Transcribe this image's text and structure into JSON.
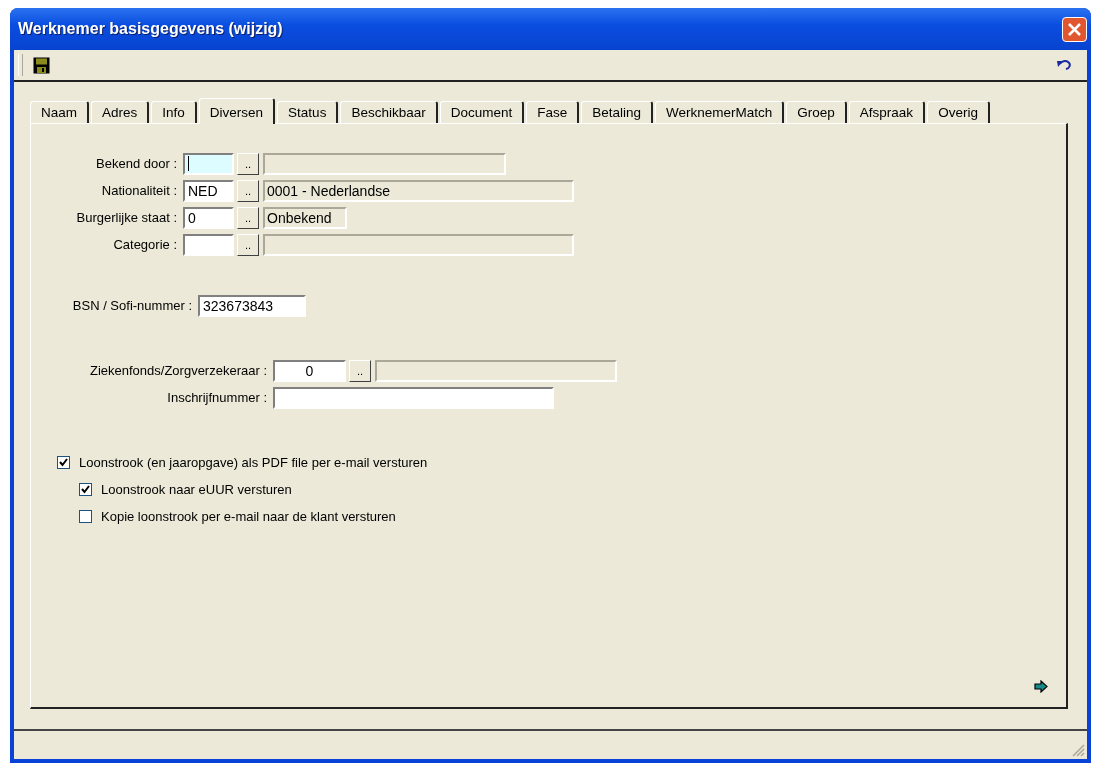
{
  "window": {
    "title": "Werknemer basisgegevens  (wijzig)"
  },
  "tabs": [
    {
      "label": "Naam",
      "selected": false
    },
    {
      "label": "Adres",
      "selected": false
    },
    {
      "label": "Info",
      "selected": false
    },
    {
      "label": "Diversen",
      "selected": true
    },
    {
      "label": "Status",
      "selected": false
    },
    {
      "label": "Beschikbaar",
      "selected": false
    },
    {
      "label": "Document",
      "selected": false
    },
    {
      "label": "Fase",
      "selected": false
    },
    {
      "label": "Betaling",
      "selected": false
    },
    {
      "label": "WerknemerMatch",
      "selected": false
    },
    {
      "label": "Groep",
      "selected": false
    },
    {
      "label": "Afspraak",
      "selected": false
    },
    {
      "label": "Overig",
      "selected": false
    }
  ],
  "lookups": [
    {
      "label": "Bekend door :",
      "focused": true,
      "browse": ".."
    },
    {
      "label": "Nationaliteit :",
      "code": "NED",
      "focused": false,
      "browse": "..",
      "description": "0001 - Nederlandse"
    },
    {
      "label": "Burgerlijke staat :",
      "code": "0",
      "focused": false,
      "browse": "..",
      "description": "Onbekend"
    },
    {
      "label": "Categorie :",
      "focused": false,
      "browse": ".."
    }
  ],
  "bsn": {
    "label": "BSN / Sofi-nummer :",
    "value": "323673843"
  },
  "insurer": {
    "label": "Ziekenfonds/Zorgverzekeraar :",
    "code": "0",
    "browse": ".."
  },
  "registration": {
    "label": "Inschrijfnummer :"
  },
  "options": [
    {
      "label": "Loonstrook (en jaaropgave) als PDF file per e-mail versturen",
      "checked": true,
      "children": [
        {
          "label": "Loonstrook naar eUUR versturen",
          "checked": true
        },
        {
          "label": "Kopie loonstrook per e-mail naar de klant versturen",
          "checked": false
        }
      ]
    }
  ]
}
